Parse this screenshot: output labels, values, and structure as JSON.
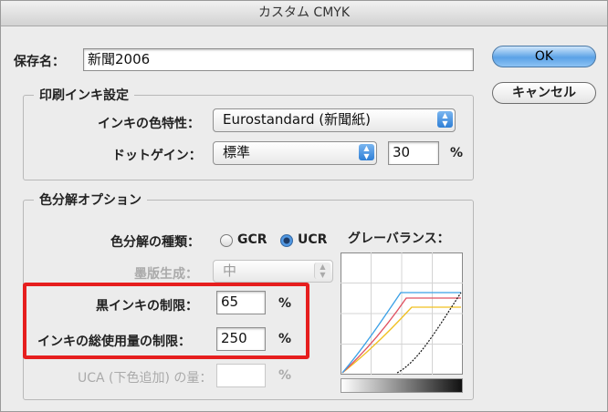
{
  "window": {
    "title": "カスタム CMYK"
  },
  "save_name": {
    "label": "保存名：",
    "value": "新聞2006"
  },
  "buttons": {
    "ok": "OK",
    "cancel": "キャンセル"
  },
  "ink_settings": {
    "group_title": "印刷インキ設定",
    "ink_color_label": "インキの色特性：",
    "ink_color_value": "Eurostandard (新聞紙)",
    "dot_gain_label": "ドットゲイン：",
    "dot_gain_value": "標準",
    "dot_gain_number": "30",
    "dot_gain_unit": "%"
  },
  "separation": {
    "group_title": "色分解オプション",
    "type_label": "色分解の種類：",
    "gcr_label": "GCR",
    "ucr_label": "UCR",
    "selected": "UCR",
    "black_gen_label": "墨版生成：",
    "black_gen_value": "中",
    "black_limit_label": "黒インキの制限：",
    "black_limit_value": "65",
    "total_ink_label": "インキの総使用量の制限：",
    "total_ink_value": "250",
    "uca_label": "UCA (下色追加) の量：",
    "uca_value": "",
    "percent": "%",
    "gray_balance_label": "グレーバランス："
  },
  "colors": {
    "highlight": "#e61e1e",
    "cyan": "#3aa0e6",
    "magenta": "#e05060",
    "yellow": "#f0c020",
    "black": "#111111"
  }
}
